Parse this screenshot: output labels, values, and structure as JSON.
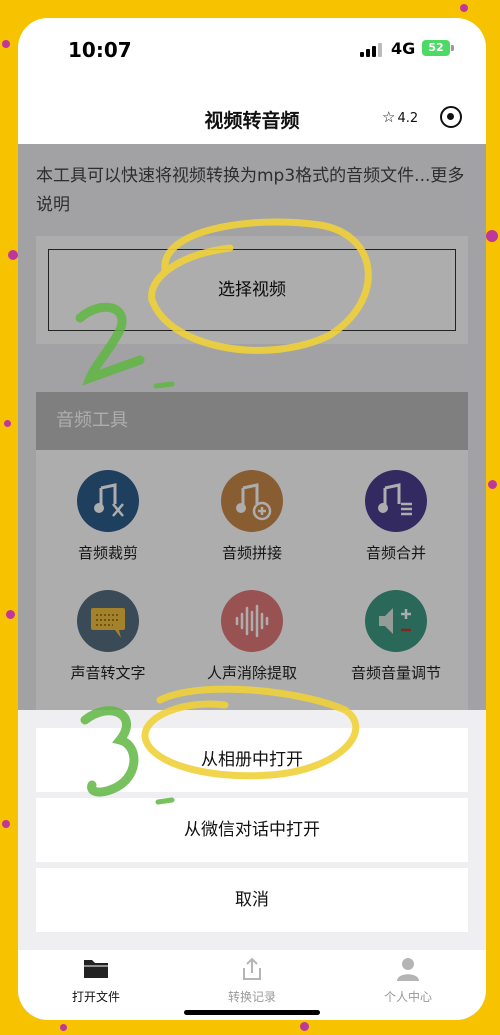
{
  "status_bar": {
    "time": "10:07",
    "network": "4G",
    "battery": "52"
  },
  "nav": {
    "title": "视频转音频",
    "rating": "4.2"
  },
  "intro": {
    "text": "本工具可以快速将视频转换为mp3格式的音频文件...更多说明"
  },
  "select_video": {
    "label": "选择视频"
  },
  "tools": {
    "header": "音频工具",
    "items": [
      {
        "label": "音频裁剪",
        "icon": "music-scissors-icon",
        "color": "#2e5d8c"
      },
      {
        "label": "音频拼接",
        "icon": "music-plus-icon",
        "color": "#c98a4b"
      },
      {
        "label": "音频合并",
        "icon": "music-list-icon",
        "color": "#4b3f8f"
      },
      {
        "label": "声音转文字",
        "icon": "speech-to-text-icon",
        "color": "#566d80"
      },
      {
        "label": "人声消除提取",
        "icon": "waveform-icon",
        "color": "#e07a7a"
      },
      {
        "label": "音频音量调节",
        "icon": "volume-adjust-icon",
        "color": "#3f9a83"
      }
    ]
  },
  "action_sheet": {
    "open_album": "从相册中打开",
    "open_wechat": "从微信对话中打开",
    "cancel": "取消"
  },
  "tabbar": {
    "items": [
      {
        "label": "打开文件",
        "icon": "folder-icon",
        "active": true
      },
      {
        "label": "转换记录",
        "icon": "share-icon",
        "active": false
      },
      {
        "label": "个人中心",
        "icon": "person-icon",
        "active": false
      }
    ]
  },
  "colors": {
    "background": "#f7c300",
    "annotation_yellow": "#f0d23a",
    "annotation_green": "#5fb642"
  }
}
